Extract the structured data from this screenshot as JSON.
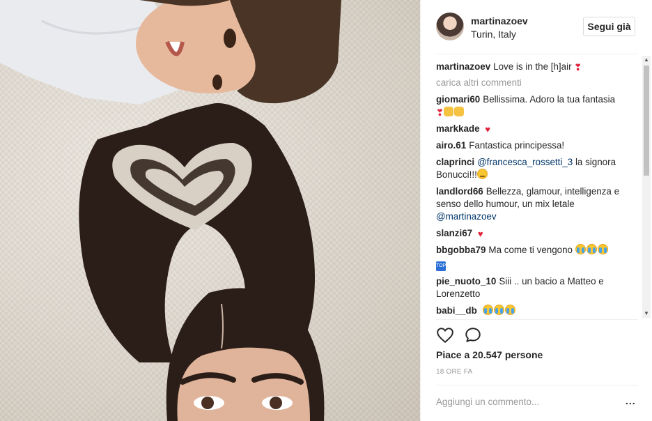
{
  "post": {
    "username": "martinazoev",
    "location": "Turin, Italy",
    "follow_label": "Segui già",
    "caption_user": "martinazoev",
    "caption_text": "Love is in the [h]air",
    "load_more": "carica altri commenti",
    "likes": "Piace a 20.547 persone",
    "time": "18 ORE FA",
    "add_comment_placeholder": "Aggiungi un commento...",
    "more_label": "..."
  },
  "comments": [
    {
      "user": "giomari60",
      "text": "Bellissima. Adoro la tua fantasia"
    },
    {
      "user": "markkade",
      "text": ""
    },
    {
      "user": "airo.61",
      "text": "Fantastica principessa!"
    },
    {
      "user": "claprinci",
      "mention": "@francesca_rossetti_3",
      "text": " la signora Bonucci!!!"
    },
    {
      "user": "landlord66",
      "text": "Bellezza, glamour, intelligenza e senso dello humour, un mix letale",
      "mention": "@martinazoev"
    },
    {
      "user": "slanzi67",
      "text": ""
    },
    {
      "user": "bbgobba79",
      "text": "Ma come ti vengono"
    },
    {
      "user": "pie_nuoto_10",
      "text": "Siii .. un bacio a Matteo e Lorenzetto"
    },
    {
      "user": "babi__db",
      "text": ""
    }
  ],
  "icons": {
    "like": "heart-outline-icon",
    "comment": "speech-bubble-icon",
    "top": "TOP"
  },
  "colors": {
    "heart": "#e0243b",
    "mention": "#003569",
    "muted": "#999999"
  }
}
